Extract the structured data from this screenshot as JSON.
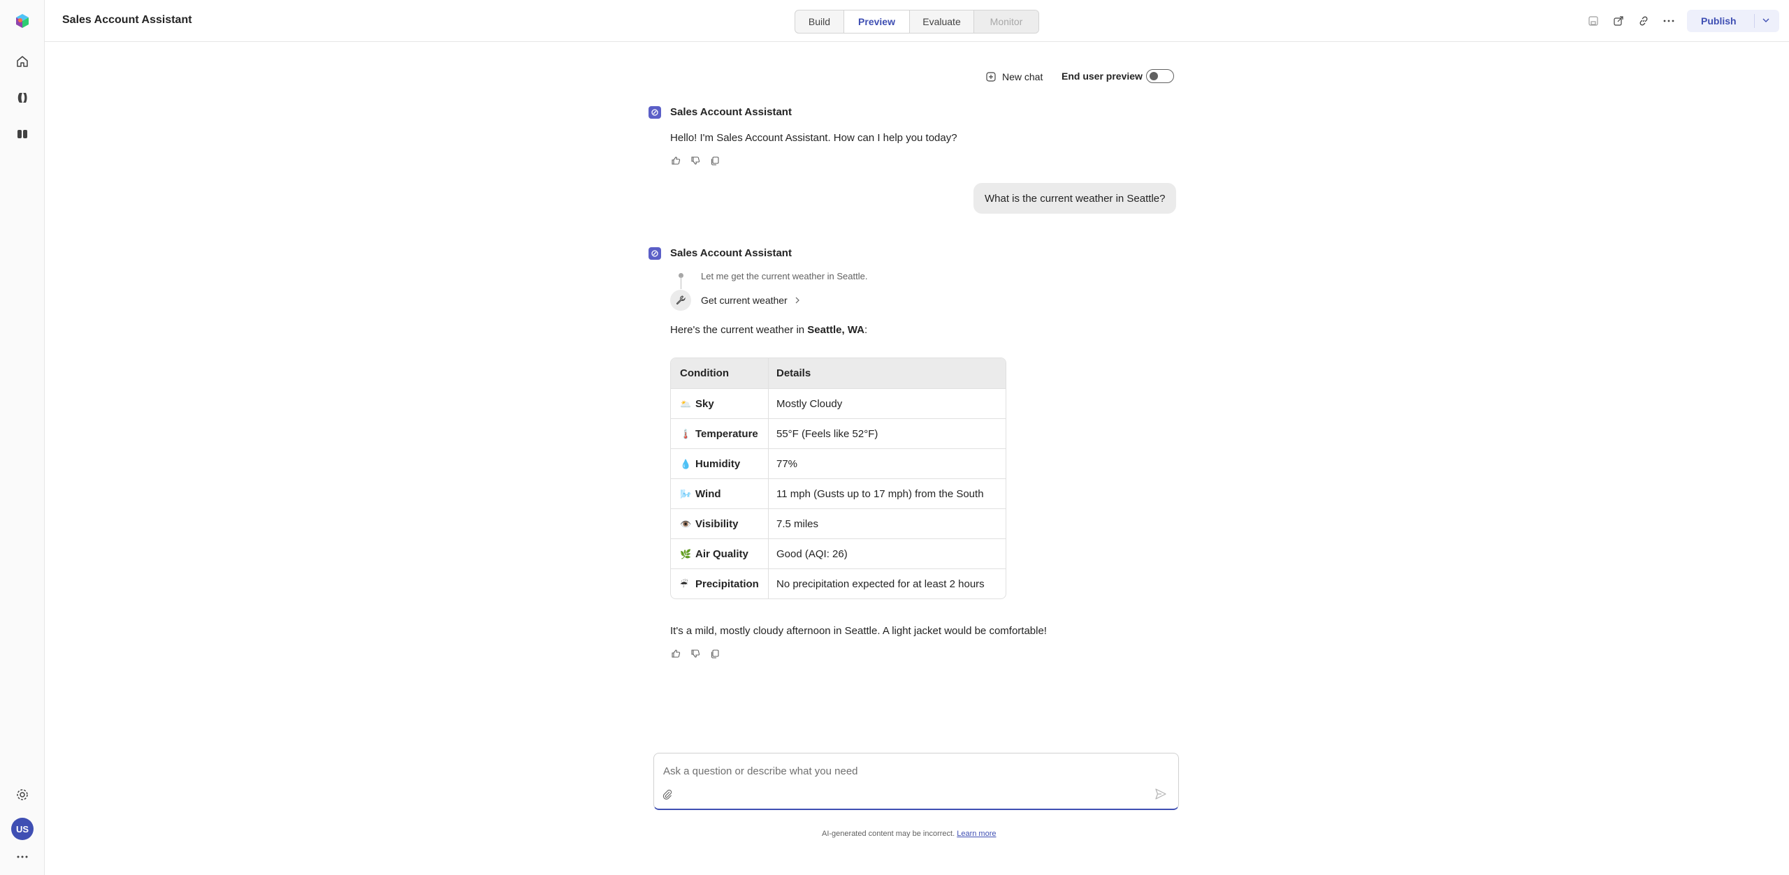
{
  "app": {
    "title": "Sales Account Assistant"
  },
  "tabs": [
    {
      "label": "Build",
      "state": "normal"
    },
    {
      "label": "Preview",
      "state": "active"
    },
    {
      "label": "Evaluate",
      "state": "normal"
    },
    {
      "label": "Monitor",
      "state": "disabled"
    }
  ],
  "header_actions": {
    "publish_label": "Publish",
    "icons": [
      "save-icon",
      "share-icon",
      "link-icon",
      "more-icon",
      "chevron-down-icon"
    ]
  },
  "rail": {
    "icons": [
      "app-logo-icon",
      "home-icon",
      "agents-icon",
      "library-icon",
      "settings-icon",
      "more-icon"
    ],
    "user_initials": "US"
  },
  "chat_controls": {
    "new_chat_label": "New chat",
    "end_user_preview_label": "End user preview",
    "end_user_preview_on": false
  },
  "messages": {
    "bot_name": "Sales Account Assistant",
    "greeting": "Hello! I'm Sales Account Assistant. How can I help you today?",
    "user_question": "What is the current weather in Seattle?",
    "thinking_step": "Let me get the current weather in Seattle.",
    "tool_call": "Get current weather",
    "intro_prefix": "Here's the current weather in ",
    "intro_location": "Seattle, WA",
    "intro_suffix": ":",
    "closing": "It's a mild, mostly cloudy afternoon in Seattle. A light jacket would be comfortable!"
  },
  "weather_table": {
    "headers": [
      "Condition",
      "Details"
    ],
    "rows": [
      {
        "emoji": "🌥️",
        "condition": "Sky",
        "details": "Mostly Cloudy"
      },
      {
        "emoji": "🌡️",
        "condition": "Temperature",
        "details": "55°F (Feels like 52°F)"
      },
      {
        "emoji": "💧",
        "condition": "Humidity",
        "details": "77%"
      },
      {
        "emoji": "🌬️",
        "condition": "Wind",
        "details": "11 mph (Gusts up to 17 mph) from the South"
      },
      {
        "emoji": "👁️",
        "condition": "Visibility",
        "details": "7.5 miles"
      },
      {
        "emoji": "🌿",
        "condition": "Air Quality",
        "details": "Good (AQI: 26)"
      },
      {
        "emoji": "☔",
        "condition": "Precipitation",
        "details": "No precipitation expected for at least 2 hours"
      }
    ]
  },
  "composer": {
    "placeholder": "Ask a question or describe what you need"
  },
  "footer": {
    "disclaimer": "AI-generated content may be incorrect.",
    "learn_more": "Learn more"
  },
  "colors": {
    "accent": "#3f4fb3",
    "bot_avatar": "#5b5fc7",
    "user_bubble": "#ebebeb"
  }
}
